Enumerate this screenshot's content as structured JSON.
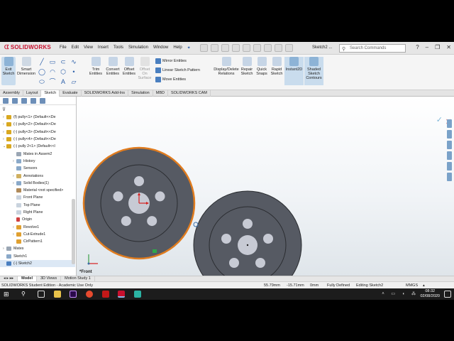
{
  "app": {
    "brand": "SOLIDWORKS",
    "menu": [
      "File",
      "Edit",
      "View",
      "Insert",
      "Tools",
      "Simulation",
      "Window",
      "Help"
    ],
    "doc_title": "Sketch2 ...",
    "search_placeholder": "Search Commands"
  },
  "ribbon": {
    "exit_sketch": "Exit Sketch",
    "smart_dimension": "Smart Dimension",
    "trim_entities": "Trim Entities",
    "convert_entities": "Convert Entities",
    "offset_entities": "Offset Entities",
    "offset_on_surface": "Offset On Surface",
    "mirror_entities": "Mirror Entities",
    "linear_sketch_pattern": "Linear Sketch Pattern",
    "move_entities": "Move Entities",
    "display_delete_relations": "Display/Delete Relations",
    "repair_sketch": "Repair Sketch",
    "quick_snaps": "Quick Snaps",
    "rapid_sketch": "Rapid Sketch",
    "instant2d": "Instant2D",
    "shaded_sketch_contours": "Shaded Sketch Contours"
  },
  "tabs": [
    "Assembly",
    "Layout",
    "Sketch",
    "Evaluate",
    "SOLIDWORKS Add-Ins",
    "Simulation",
    "MBD",
    "SOLIDWORKS CAM"
  ],
  "active_tab": "Sketch",
  "tree": [
    {
      "label": "(f) pully<1> (Default<<De",
      "expand": "›"
    },
    {
      "label": "(-) pully<2> (Default<<De",
      "expand": "›"
    },
    {
      "label": "(-) pully<3> (Default<<De",
      "expand": "›"
    },
    {
      "label": "(-) pully<4> (Default<<De",
      "expand": "›"
    },
    {
      "label": "(-) pully 2<1> (Default<<I",
      "expand": "⌄"
    },
    {
      "label": "Mates in Assem2",
      "expand": ""
    },
    {
      "label": "History",
      "expand": "›"
    },
    {
      "label": "Sensors",
      "expand": ""
    },
    {
      "label": "Annotations",
      "expand": "›"
    },
    {
      "label": "Solid Bodies(1)",
      "expand": "›"
    },
    {
      "label": "Material <not specified>",
      "expand": ""
    },
    {
      "label": "Front Plane",
      "expand": ""
    },
    {
      "label": "Top Plane",
      "expand": ""
    },
    {
      "label": "Right Plane",
      "expand": ""
    },
    {
      "label": "Origin",
      "expand": ""
    },
    {
      "label": "Revolve1",
      "expand": "›"
    },
    {
      "label": "Cut-Extrude1",
      "expand": "›"
    },
    {
      "label": "CirPattern1",
      "expand": ""
    },
    {
      "label": "Mates",
      "expand": "›"
    },
    {
      "label": "Sketch1",
      "expand": ""
    },
    {
      "label": "(-) Sketch2",
      "expand": ""
    }
  ],
  "bottom_tabs": [
    "Model",
    "3D Views",
    "Motion Study 1"
  ],
  "active_bottom_tab": "Model",
  "view_label": "*Front",
  "status": {
    "edition": "SOLIDWORKS Student Edition - Academic Use Only",
    "x": "55.79mm",
    "y": "-15.71mm",
    "z": "0mm",
    "defined": "Fully Defined",
    "editing": "Editing Sketch2",
    "units": "MMGS"
  },
  "taskbar": {
    "time": "08:32",
    "date": "02/08/2020"
  },
  "colors": {
    "part_fill": "#565a63",
    "selection_outline": "#e07c1f",
    "accent": "#c8102e"
  }
}
